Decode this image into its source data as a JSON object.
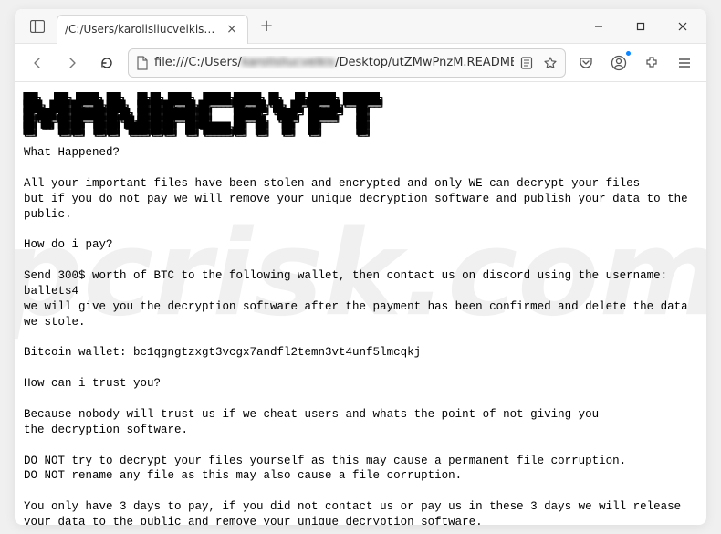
{
  "tab": {
    "title": "/C:/Users/karolisliucveikis/Desktop/"
  },
  "url": {
    "prefix": "file:///C:/Users/",
    "blurred": "karolisliucveikis",
    "suffix": "/Desktop/utZMwPnzM.README.txt"
  },
  "watermark": "pcrisk.com",
  "note": {
    "ascii_title": "███╗   ███╗ █████╗ ███╗   ██╗██╗ █████╗  ██████╗██████╗ ██╗   ██╗██████╗ ████████╗\n████╗ ████║██╔══██╗████╗  ██║██║██╔══██╗██╔════╝██╔══██╗╚██╗ ██╔╝██╔══██╗╚══██╔══╝\n██╔████╔██║███████║██╔██╗ ██║██║███████║██║     ██████╔╝ ╚████╔╝ ██████╔╝   ██║   \n██║╚██╔╝██║██╔══██║██║╚██╗██║██║██╔══██║██║     ██╔══██╗  ╚██╔╝  ██╔═══╝    ██║   \n██║ ╚═╝ ██║██║  ██║██║ ╚████║██║██║  ██║╚██████╗██║  ██║   ██║   ██║        ██║   \n╚═╝     ╚═╝╚═╝  ╚═╝╚═╝  ╚═══╝╚═╝╚═╝  ╚═╝ ╚═════╝╚═╝  ╚═╝   ╚═╝   ╚═╝        ╚═╝   ",
    "body": "What Happened?\n\nAll your important files have been stolen and encrypted and only WE can decrypt your files\nbut if you do not pay we will remove your unique decryption software and publish your data to the public.\n\nHow do i pay?\n\nSend 300$ worth of BTC to the following wallet, then contact us on discord using the username: ballets4\nwe will give you the decryption software after the payment has been confirmed and delete the data we stole.\n\nBitcoin wallet: bc1qgngtzxgt3vcgx7andfl2temn3vt4unf5lmcqkj\n\nHow can i trust you?\n\nBecause nobody will trust us if we cheat users and whats the point of not giving you\nthe decryption software.\n\nDO NOT try to decrypt your files yourself as this may cause a permanent file corruption.\nDO NOT rename any file as this may also cause a file corruption.\n\nYou only have 3 days to pay, if you did not contact us or pay us in these 3 days we will release\nyour data to the public and remove your unique decryption software."
  }
}
